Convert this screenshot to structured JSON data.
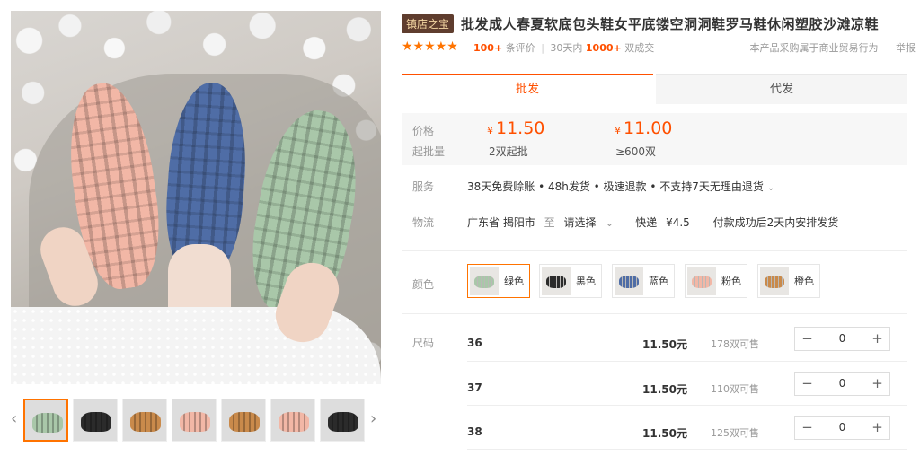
{
  "product": {
    "badge": "镇店之宝",
    "title": "批发成人春夏软底包头鞋女平底镂空洞洞鞋罗马鞋休闲塑胶沙滩凉鞋",
    "stars": "★★★★★",
    "reviews_count": "100+",
    "reviews_label": "条评价",
    "sales_period": "30天内",
    "sales_count": "1000+",
    "sales_label": "双成交",
    "notice": "本产品采购属于商业贸易行为",
    "report": "举报"
  },
  "tabs": {
    "wholesale": "批发",
    "dropship": "代发"
  },
  "pricing": {
    "price_label": "价格",
    "moq_label": "起批量",
    "currency": "¥",
    "tiers": [
      {
        "price": "11.50",
        "qty": "2双起批"
      },
      {
        "price": "11.00",
        "qty": "≥600双"
      }
    ]
  },
  "service": {
    "label": "服务",
    "text": "38天免费赊账 • 48h发货 • 极速退款 • 不支持7天无理由退货",
    "chevron": "⌄"
  },
  "logistics": {
    "label": "物流",
    "origin": "广东省 揭阳市",
    "to": "至",
    "destination": "请选择",
    "chevron": "⌄",
    "express": "快递",
    "fee": "¥4.5",
    "ship_note": "付款成功后2天内安排发货"
  },
  "colors": {
    "label": "颜色",
    "options": [
      {
        "name": "绿色",
        "hex": "#a9c7a9"
      },
      {
        "name": "黑色",
        "hex": "#2b2b2b"
      },
      {
        "name": "蓝色",
        "hex": "#4f6da6"
      },
      {
        "name": "粉色",
        "hex": "#f2b7a6"
      },
      {
        "name": "橙色",
        "hex": "#c98a4b"
      }
    ]
  },
  "sizes": {
    "label": "尺码",
    "rows": [
      {
        "size": "36",
        "price": "11.50元",
        "stock": "178双可售",
        "qty": "0"
      },
      {
        "size": "37",
        "price": "11.50元",
        "stock": "110双可售",
        "qty": "0"
      },
      {
        "size": "38",
        "price": "11.50元",
        "stock": "125双可售",
        "qty": "0"
      }
    ],
    "minus": "−",
    "plus": "+"
  },
  "gallery": {
    "prev": "‹",
    "next": "›",
    "thumb_colors": [
      "#a9c7a9",
      "#2b2b2b",
      "#c98a4b",
      "#f2b7a6",
      "#c98a4b",
      "#f2b7a6",
      "#2b2b2b"
    ]
  },
  "accent": "#ff5000"
}
